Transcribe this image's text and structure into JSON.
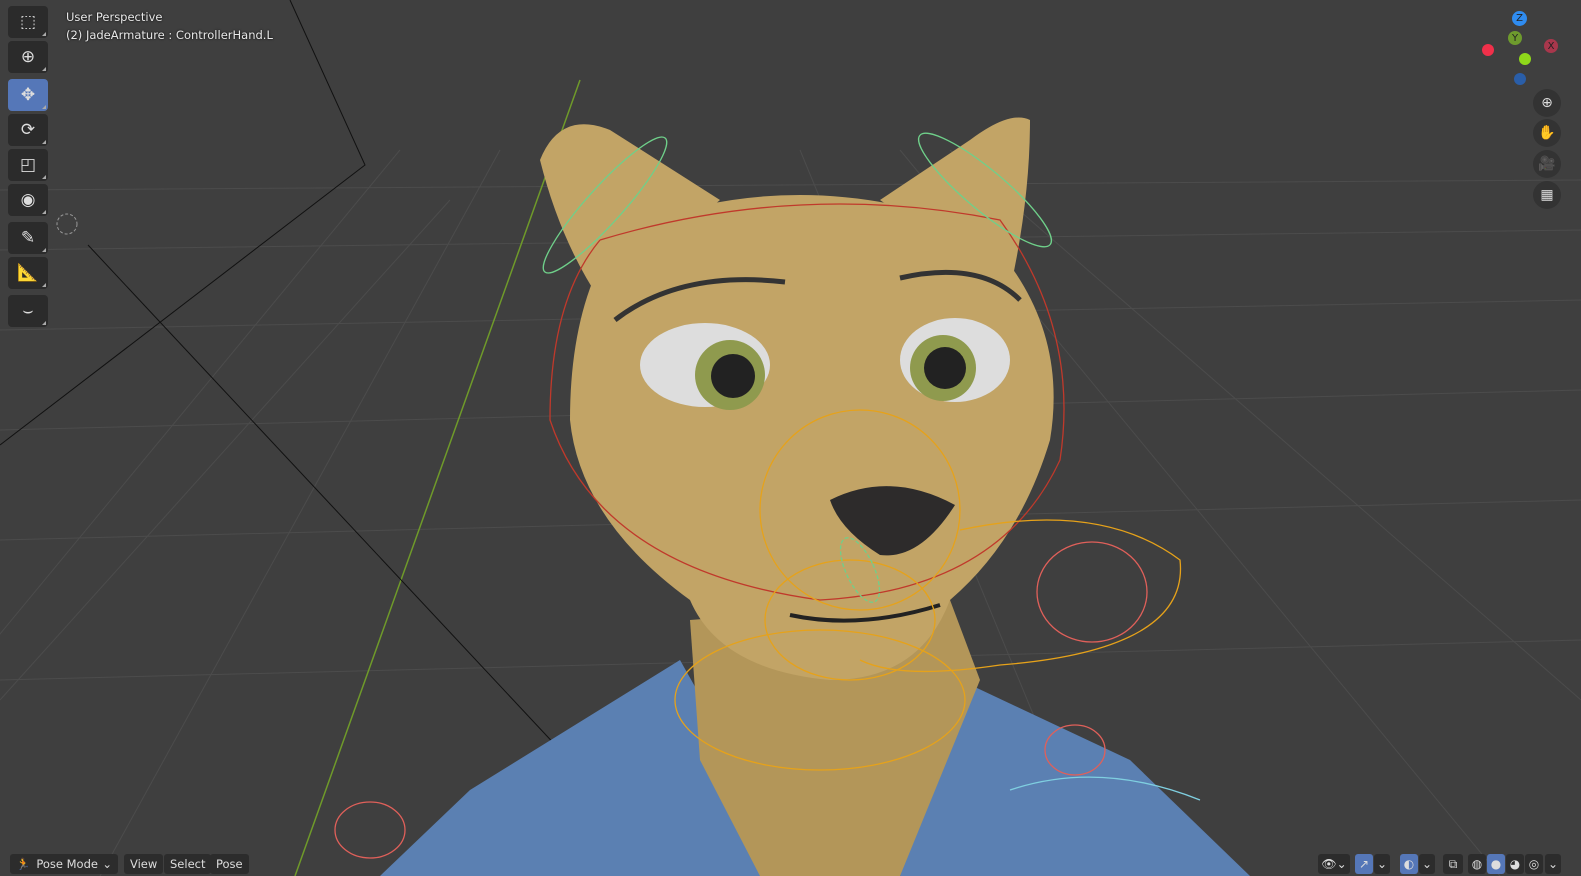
{
  "viewport": {
    "view_name": "User Perspective",
    "active_object": "(2) JadeArmature : ControllerHand.L"
  },
  "toolbar": {
    "tools": [
      {
        "name": "select-box",
        "icon": "select-box-icon",
        "active": false
      },
      {
        "name": "cursor",
        "icon": "cursor-icon",
        "active": false
      },
      {
        "name": "move",
        "icon": "move-icon",
        "active": true
      },
      {
        "name": "rotate",
        "icon": "rotate-icon",
        "active": false
      },
      {
        "name": "scale",
        "icon": "scale-icon",
        "active": false
      },
      {
        "name": "transform",
        "icon": "transform-icon",
        "active": false
      },
      {
        "name": "annotate",
        "icon": "annotate-icon",
        "active": false
      },
      {
        "name": "measure",
        "icon": "measure-icon",
        "active": false
      },
      {
        "name": "relax",
        "icon": "relax-icon",
        "active": false
      }
    ]
  },
  "gizmo": {
    "x_label": "X",
    "y_label": "Y",
    "z_label": "Z",
    "x_color": "#c8374c",
    "y_color": "#6e9b2d",
    "z_color": "#2f8cf0"
  },
  "header": {
    "mode_label": "Pose Mode",
    "menus": [
      "View",
      "Select",
      "Pose"
    ]
  },
  "colors": {
    "accent": "#5577b8",
    "skin": "#c2a466",
    "shirt": "#5b80b2",
    "bone_orange": "#e6a21a",
    "bone_red": "#e0605a",
    "bone_green": "#6fd08a"
  }
}
